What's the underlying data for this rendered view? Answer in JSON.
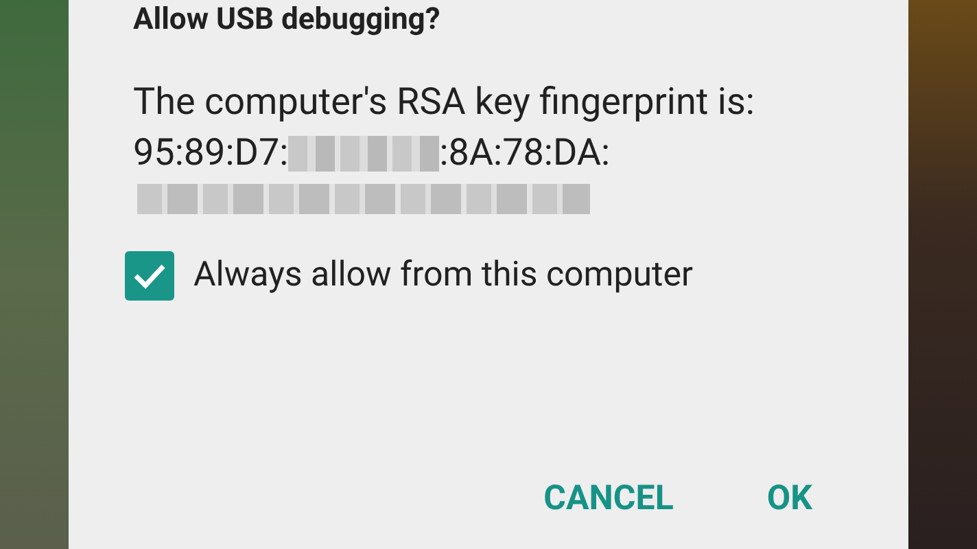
{
  "dialog": {
    "title": "Allow USB debugging?",
    "message": "The computer's RSA key fingerprint is:",
    "fingerprint": {
      "start": "95:89:D7:",
      "end": ":8A:78:DA:"
    },
    "checkbox": {
      "label": "Always allow from this computer",
      "checked": true
    },
    "buttons": [
      {
        "label": "CANCEL"
      },
      {
        "label": "OK"
      }
    ]
  }
}
